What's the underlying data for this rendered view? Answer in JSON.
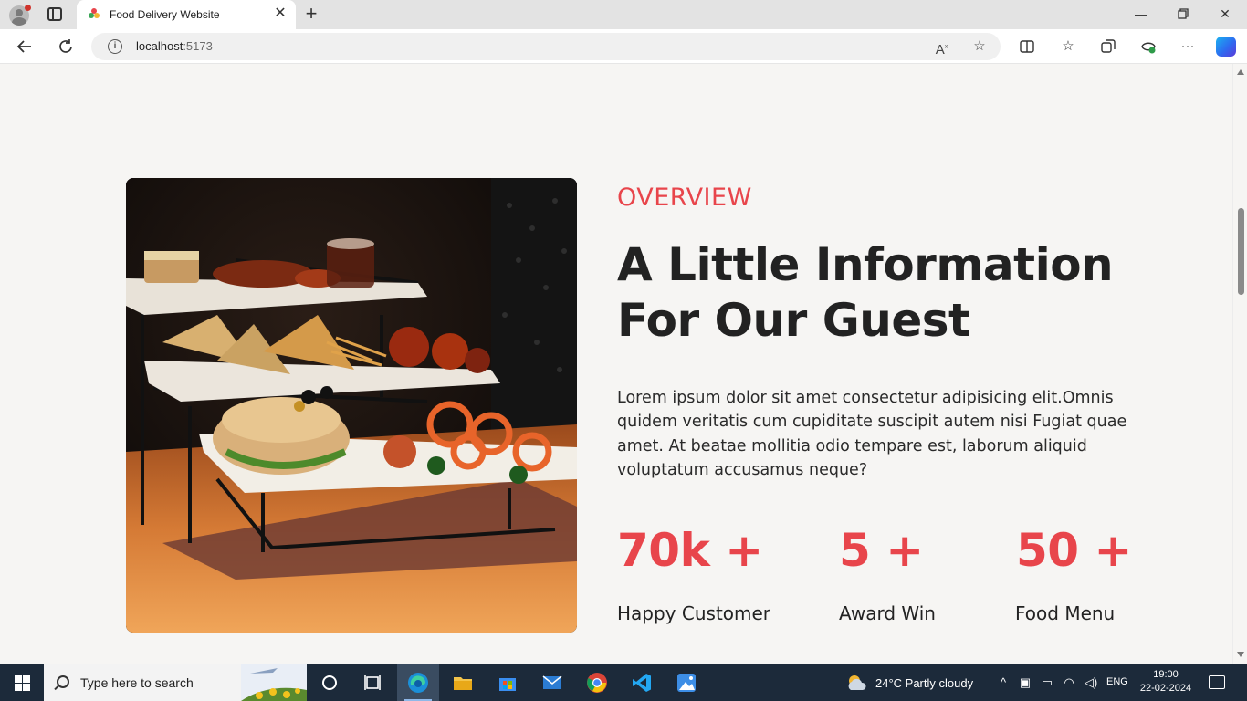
{
  "browser": {
    "tab_title": "Food Delivery Website",
    "url_host": "localhost",
    "url_port": ":5173"
  },
  "page": {
    "eyebrow": "OVERVIEW",
    "headline_line1": "A Little Information",
    "headline_line2": "For Our Guest",
    "description": "Lorem ipsum dolor sit amet consectetur adipisicing elit.Omnis quidem veritatis cum cupiditate suscipit autem nisi Fugiat quae amet. At beatae mollitia odio tempare est, laborum aliquid voluptatum accusamus neque?",
    "stats": [
      {
        "value": "70k +",
        "label": "Happy Customer"
      },
      {
        "value": "5 +",
        "label": "Award Win"
      },
      {
        "value": "50 +",
        "label": "Food Menu"
      }
    ],
    "accent_color": "#e8454b",
    "text_color": "#222222"
  },
  "taskbar": {
    "search_placeholder": "Type here to search",
    "weather": "24°C  Partly cloudy",
    "language": "ENG",
    "time": "19:00",
    "date": "22-02-2024"
  }
}
